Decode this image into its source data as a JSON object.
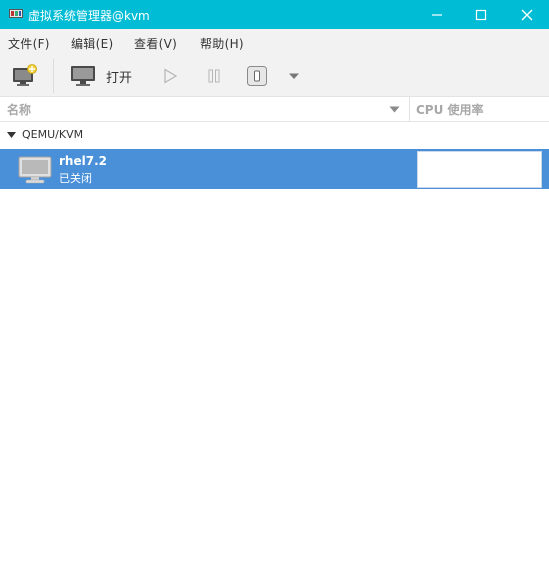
{
  "window": {
    "title": "虚拟系统管理器@kvm"
  },
  "menu": {
    "items": [
      {
        "label": "文件(F)"
      },
      {
        "label": "编辑(E)"
      },
      {
        "label": "查看(V)"
      },
      {
        "label": "帮助(H)"
      }
    ]
  },
  "toolbar": {
    "open_label": "打开",
    "icons": [
      "new-vm-icon",
      "monitor-icon",
      "play-icon",
      "pause-icon",
      "shutdown-icon",
      "dropdown-arrow-icon"
    ]
  },
  "columns": {
    "name": "名称",
    "cpu": "CPU 使用率"
  },
  "connection": {
    "label": "QEMU/KVM",
    "expanded": true
  },
  "vms": [
    {
      "name": "rhel7.2",
      "state": "已关闭",
      "selected": true,
      "cpu_usage": 0
    }
  ],
  "colors": {
    "titlebar": "#00bcd4",
    "selection": "#4a90d9",
    "menubar": "#f2f2f2"
  }
}
